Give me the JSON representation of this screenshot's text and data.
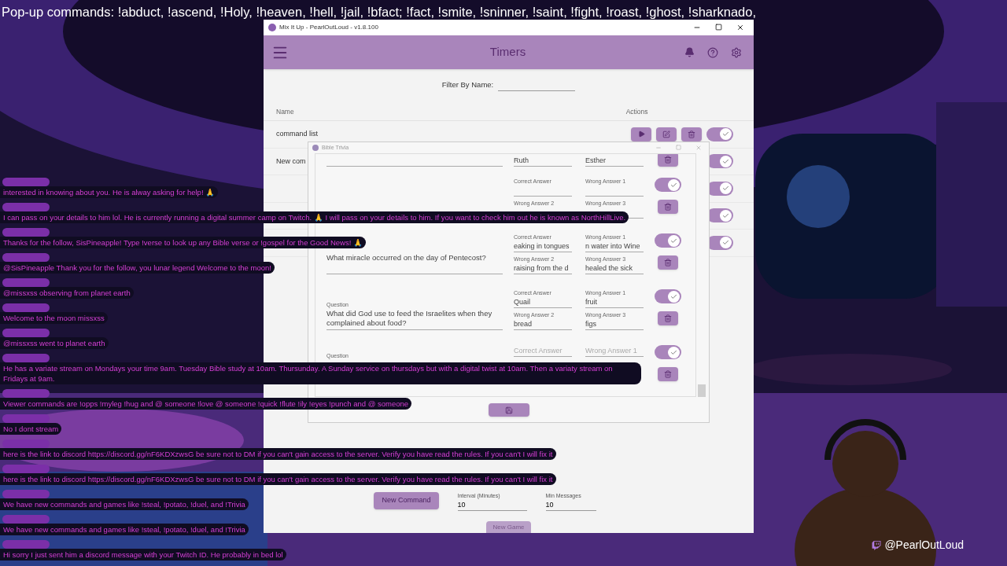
{
  "overlay_title": "Pop-up commands: !abduct, !ascend, !Holy, !heaven, !hell,  !jail, !bfact; !fact, !smite, !sninner, !saint, !fight, !roast, !ghost, !sharknado,",
  "app": {
    "title": "Mix It Up - PearlOutLoud - v1.8.100",
    "page": "Timers",
    "filter_label": "Filter By Name:",
    "columns": [
      "Name",
      "Actions"
    ],
    "timers": [
      {
        "kind": "full",
        "name": "command list",
        "enabled": true
      },
      {
        "kind": "covered",
        "name": "New com",
        "enabled": true
      },
      {
        "kind": "covered",
        "enabled": true
      },
      {
        "kind": "covered",
        "enabled": true
      },
      {
        "kind": "covered",
        "enabled": true
      }
    ],
    "new_command": "New Command",
    "interval": {
      "label": "Interval (Minutes)",
      "value": "10"
    },
    "min_messages": {
      "label": "Min Messages",
      "value": "10"
    },
    "new_game": "New Game"
  },
  "dialog": {
    "title": "Bible Trivia",
    "questions": [
      {
        "kind": "partial",
        "answers": [
          {
            "value": "Ruth"
          },
          {
            "value": "Esther"
          }
        ]
      },
      {
        "kind": "full",
        "enabled": true,
        "answers": [
          {
            "label": "Correct Answer"
          },
          {
            "label": "Wrong Answer 1"
          },
          {
            "label": "Wrong Answer 2"
          },
          {
            "label": "Wrong Answer 3"
          }
        ]
      },
      {
        "kind": "full",
        "enabled": true,
        "question": "What miracle occurred on the day of Pentecost?",
        "answers": [
          {
            "label": "Correct Answer",
            "value": "eaking in tongues"
          },
          {
            "label": "Wrong Answer 1",
            "value": "n water into Wine"
          },
          {
            "label": "Wrong Answer 2",
            "value": "raising from the d"
          },
          {
            "label": "Wrong Answer 3",
            "value": "healed the sick"
          }
        ]
      },
      {
        "kind": "full",
        "enabled": true,
        "question_label": "Question",
        "question": "What did God use to feed the Israelites when they complained about food?",
        "answers": [
          {
            "label": "Correct Answer",
            "value": "Quail"
          },
          {
            "label": "Wrong Answer 1",
            "value": "fruit"
          },
          {
            "label": "Wrong Answer 2",
            "value": "bread"
          },
          {
            "label": "Wrong Answer 3",
            "value": "figs"
          }
        ]
      },
      {
        "kind": "full",
        "enabled": true,
        "question_label": "Question",
        "answers": [
          {
            "placeholder": "Correct Answer"
          },
          {
            "placeholder": "Wrong Answer 1"
          }
        ]
      }
    ]
  },
  "chat": [
    {
      "text": "interested in knowing about you. He is alway asking for help! 🙏"
    },
    {
      "text": "I can pass on your details to him lol. He is currently running a digital summer camp on Twitch. 🙏 I will pass on your details to him. If you want to check him out he is known as NorthHillLive."
    },
    {
      "text": "Thanks for the follow, SisPineapple! Type !verse to look up any Bible verse or !gospel for the Good News! 🙏"
    },
    {
      "text": "@SisPineapple Thank you for the follow, you lunar legend Welcome to the moon!"
    },
    {
      "text": "@missxss observing from planet earth"
    },
    {
      "text": "Welcome to the moon missxss"
    },
    {
      "text": "@missxss went to planet earth"
    },
    {
      "text": "He has a variate stream on Mondays your time 9am. Tuesday Bible study at 10am. Thursunday. A Sunday service on thursdays but with a digital twist at 10am. Then a variaty stream on Fridays at 9am."
    },
    {
      "text": "Viewer commands are !opps !myleg !hug and @ someone !love @ someone !quick !flute !ily !eyes !punch and @ someone"
    },
    {
      "text": "No I dont stream"
    },
    {
      "text": "here is the link to discord https://discord.gg/nF6KDXzwsG be sure not to DM if you can't gain access to the server. Verify you have read the rules. If you can't I will fix it"
    },
    {
      "text": "here is the link to discord https://discord.gg/nF6KDXzwsG be sure not to DM if you can't gain access to the server. Verify you have read the rules. If you can't I will fix it"
    },
    {
      "text": "We have new commands and games like !steal, !potato, !duel, and !Trivia"
    },
    {
      "text": "We have new commands and games like !steal, !potato, !duel, and !Trivia"
    },
    {
      "text": "Hi sorry I just sent him a discord message with your Twitch ID. He probably in bed lol"
    }
  ],
  "handle": "@PearlOutLoud"
}
